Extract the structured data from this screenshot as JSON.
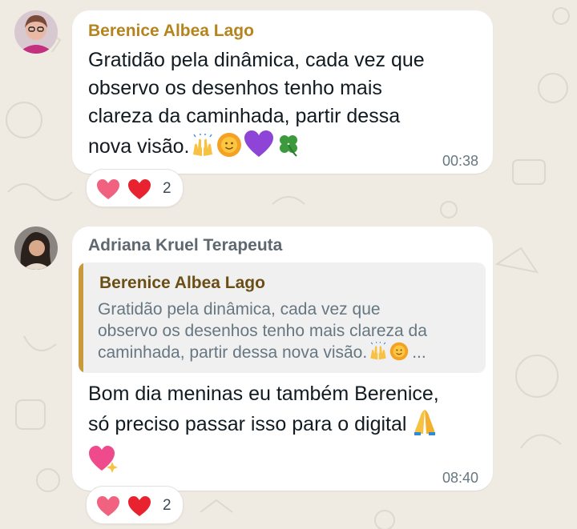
{
  "messages": [
    {
      "sender": "Berenice Albea Lago",
      "sender_color": "#b5841f",
      "text_lines": [
        "Gratidão pela dinâmica, cada vez que",
        "observo os desenhos tenho mais",
        "clareza da caminhada, partir dessa",
        "nova visão."
      ],
      "emojis": [
        "raising-hands-icon",
        "sun-face-icon",
        "purple-heart-icon",
        "clover-icon"
      ],
      "time": "00:38",
      "reactions": {
        "icons": [
          "pink-heart-icon",
          "red-heart-icon"
        ],
        "count": "2"
      }
    },
    {
      "sender": "Adriana Kruel Terapeuta",
      "sender_color": "#5e6870",
      "quote": {
        "author": "Berenice Albea Lago",
        "lines": [
          "Gratidão pela dinâmica, cada vez que",
          "observo os desenhos tenho mais clareza da",
          "caminhada, partir dessa nova visão."
        ],
        "ellipsis": "...",
        "emojis": [
          "raising-hands-icon",
          "sun-face-icon"
        ]
      },
      "text_lines": [
        "Bom dia meninas eu também Berenice,",
        "só preciso passar isso para o digital"
      ],
      "emojis": [
        "folded-hands-icon",
        "sparkling-heart-icon"
      ],
      "time": "08:40",
      "reactions": {
        "icons": [
          "pink-heart-icon",
          "red-heart-icon"
        ],
        "count": "2"
      }
    }
  ],
  "colors": {
    "wallpaper": "#efeae2",
    "bubble": "#ffffff",
    "quote_accent": "#c99a3b",
    "timestamp": "#667781"
  }
}
